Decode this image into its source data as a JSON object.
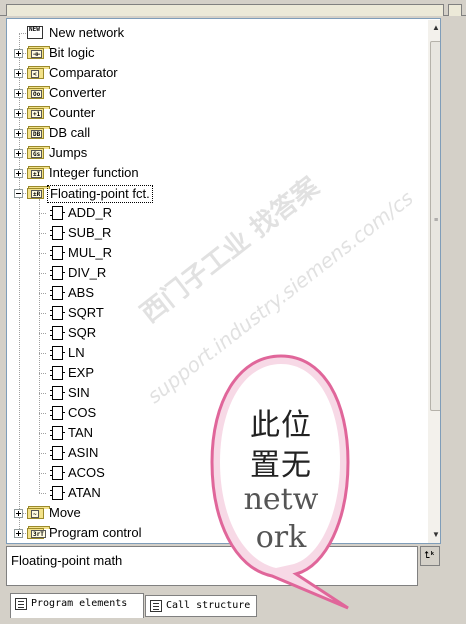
{
  "tree": {
    "items": [
      {
        "label": "New network",
        "icon": "new-network-icon",
        "badge": "NEW",
        "type": "leaf-root"
      },
      {
        "label": "Bit logic",
        "icon": "folder-icon",
        "badge": "⊣⊢",
        "type": "folder",
        "expanded": false
      },
      {
        "label": "Comparator",
        "icon": "folder-icon",
        "badge": "<",
        "type": "folder",
        "expanded": false
      },
      {
        "label": "Converter",
        "icon": "folder-icon",
        "badge": "Oo",
        "type": "folder",
        "expanded": false
      },
      {
        "label": "Counter",
        "icon": "folder-icon",
        "badge": "+1",
        "type": "folder",
        "expanded": false
      },
      {
        "label": "DB call",
        "icon": "folder-icon",
        "badge": "DB",
        "type": "folder",
        "expanded": false
      },
      {
        "label": "Jumps",
        "icon": "folder-icon",
        "badge": "Gs",
        "type": "folder",
        "expanded": false
      },
      {
        "label": "Integer function",
        "icon": "folder-icon",
        "badge": "±I",
        "type": "folder",
        "expanded": false
      },
      {
        "label": "Floating-point fct.",
        "icon": "folder-icon",
        "badge": "±R",
        "type": "folder",
        "expanded": true,
        "selected": true
      },
      {
        "label": "ADD_R",
        "icon": "function-box-icon",
        "type": "child"
      },
      {
        "label": "SUB_R",
        "icon": "function-box-icon",
        "type": "child"
      },
      {
        "label": "MUL_R",
        "icon": "function-box-icon",
        "type": "child"
      },
      {
        "label": "DIV_R",
        "icon": "function-box-icon",
        "type": "child"
      },
      {
        "label": "ABS",
        "icon": "function-box-icon",
        "type": "child"
      },
      {
        "label": "SQRT",
        "icon": "function-box-icon",
        "type": "child"
      },
      {
        "label": "SQR",
        "icon": "function-box-icon",
        "type": "child"
      },
      {
        "label": "LN",
        "icon": "function-box-icon",
        "type": "child"
      },
      {
        "label": "EXP",
        "icon": "function-box-icon",
        "type": "child"
      },
      {
        "label": "SIN",
        "icon": "function-box-icon",
        "type": "child"
      },
      {
        "label": "COS",
        "icon": "function-box-icon",
        "type": "child"
      },
      {
        "label": "TAN",
        "icon": "function-box-icon",
        "type": "child"
      },
      {
        "label": "ASIN",
        "icon": "function-box-icon",
        "type": "child"
      },
      {
        "label": "ACOS",
        "icon": "function-box-icon",
        "type": "child"
      },
      {
        "label": "ATAN",
        "icon": "function-box-icon",
        "type": "child"
      },
      {
        "label": "Move",
        "icon": "folder-icon",
        "badge": "~",
        "type": "folder",
        "expanded": false
      },
      {
        "label": "Program control",
        "icon": "folder-icon",
        "badge": "3rT",
        "type": "folder",
        "expanded": false
      }
    ]
  },
  "status": {
    "text": "Floating-point math",
    "button_label": "⮤ᵏ"
  },
  "tabs": [
    {
      "label": "Program elements",
      "active": true
    },
    {
      "label": "Call structure",
      "active": false
    }
  ],
  "watermark": {
    "line1": "西门子工业    找答案",
    "line2": "support.industry.siemens.com/cs"
  },
  "sticker": {
    "line1": "此位",
    "line2": "置无",
    "line3": "netw",
    "line4": "ork"
  },
  "colors": {
    "folder": "#f3e28a",
    "bubble_border": "#e0669a",
    "bubble_fill": "#f7d9e6",
    "panel_border": "#7f9db9",
    "chrome": "#d4d0c8"
  }
}
